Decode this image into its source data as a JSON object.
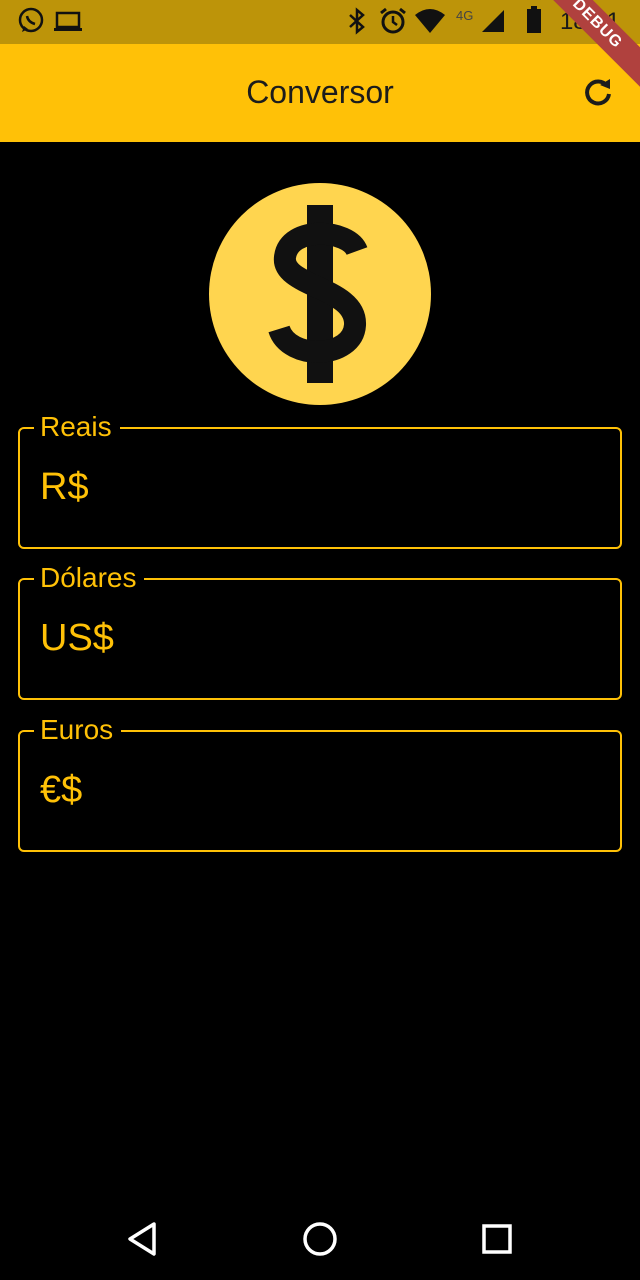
{
  "status_bar": {
    "time": "18:01",
    "network": "4G",
    "icons": [
      "whatsapp-icon",
      "laptop-icon",
      "bluetooth-icon",
      "alarm-icon",
      "wifi-icon",
      "signal-icon",
      "battery-icon"
    ]
  },
  "debug_banner": "DEBUG",
  "app_bar": {
    "title": "Conversor",
    "refresh_icon": "refresh-icon",
    "background": "#ffc107"
  },
  "coin_icon": "dollar-coin-icon",
  "fields": [
    {
      "label": "Reais",
      "prefix": "R$",
      "value": ""
    },
    {
      "label": "Dólares",
      "prefix": "US$",
      "value": ""
    },
    {
      "label": "Euros",
      "prefix": "€$",
      "value": ""
    }
  ],
  "colors": {
    "accent": "#ffc107",
    "coin": "#ffd54f",
    "background": "#000000"
  },
  "nav_bar": {
    "icons": [
      "back-icon",
      "home-icon",
      "recents-icon"
    ]
  }
}
